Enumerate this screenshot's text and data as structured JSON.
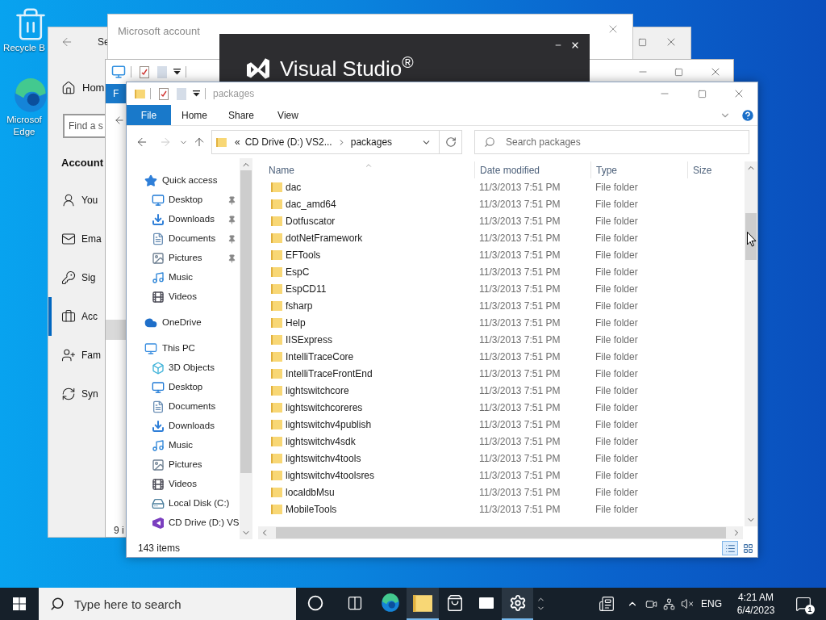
{
  "desktop_icons": [
    {
      "kind": "recycle-bin",
      "lines": [
        "Recycle B"
      ]
    },
    {
      "kind": "edge",
      "lines": [
        "Microsof",
        "Edge"
      ]
    }
  ],
  "settings_window": {
    "title": "Se",
    "home": "Hom",
    "search_placeholder": "Find a s",
    "heading": "Account",
    "nav": [
      {
        "kind": "user",
        "label": "You",
        "selected": false
      },
      {
        "kind": "mail",
        "label": "Ema",
        "selected": false
      },
      {
        "kind": "key",
        "label": "Sig",
        "selected": false
      },
      {
        "kind": "briefcase",
        "label": "Acc",
        "selected": true
      },
      {
        "kind": "family",
        "label": "Fam",
        "selected": false
      },
      {
        "kind": "sync",
        "label": "Syn",
        "selected": false
      }
    ]
  },
  "account_window": {
    "title": "Microsoft account"
  },
  "splash": {
    "title": "Visual Studio$^{®}$"
  },
  "back_explorer": {
    "menu_tab": "F",
    "status": "9 i"
  },
  "explorer": {
    "title": "packages",
    "ribbon_tabs": [
      {
        "kind": "file-menu",
        "label": "File"
      },
      {
        "kind": "tab",
        "label": "Home"
      },
      {
        "kind": "tab",
        "label": "Share"
      },
      {
        "kind": "tab",
        "label": "View"
      }
    ],
    "nav_buttons": [
      {
        "kind": "back",
        "disabled": false
      },
      {
        "kind": "forward",
        "disabled": true
      }
    ],
    "address": {
      "overflow": "«",
      "crumbs": [
        "CD Drive (D:) VS2...",
        "packages"
      ]
    },
    "search": {
      "placeholder": "Search packages"
    },
    "nav_pane": [
      {
        "kind": "quick-access",
        "label": "Quick access",
        "children": [
          {
            "kind": "desktop",
            "label": "Desktop",
            "pinned": true
          },
          {
            "kind": "downloads",
            "label": "Downloads",
            "pinned": true
          },
          {
            "kind": "documents",
            "label": "Documents",
            "pinned": true
          },
          {
            "kind": "pictures",
            "label": "Pictures",
            "pinned": true
          },
          {
            "kind": "music",
            "label": "Music",
            "pinned": false
          },
          {
            "kind": "videos",
            "label": "Videos",
            "pinned": false
          }
        ]
      },
      {
        "kind": "onedrive",
        "label": "OneDrive"
      },
      {
        "kind": "pc",
        "label": "This PC",
        "children": [
          {
            "kind": "objects",
            "label": "3D Objects"
          },
          {
            "kind": "desktop",
            "label": "Desktop"
          },
          {
            "kind": "documents",
            "label": "Documents"
          },
          {
            "kind": "downloads",
            "label": "Downloads"
          },
          {
            "kind": "music",
            "label": "Music"
          },
          {
            "kind": "pictures",
            "label": "Pictures"
          },
          {
            "kind": "videos",
            "label": "Videos"
          },
          {
            "kind": "disk",
            "label": "Local Disk (C:)"
          },
          {
            "kind": "cd",
            "label": "CD Drive (D:) VS"
          }
        ]
      }
    ],
    "columns": [
      "Name",
      "Date modified",
      "Type",
      "Size"
    ],
    "rows": [
      {
        "name": "dac",
        "date": "11/3/2013 7:51 PM",
        "type": "File folder"
      },
      {
        "name": "dac_amd64",
        "date": "11/3/2013 7:51 PM",
        "type": "File folder"
      },
      {
        "name": "Dotfuscator",
        "date": "11/3/2013 7:51 PM",
        "type": "File folder"
      },
      {
        "name": "dotNetFramework",
        "date": "11/3/2013 7:51 PM",
        "type": "File folder"
      },
      {
        "name": "EFTools",
        "date": "11/3/2013 7:51 PM",
        "type": "File folder"
      },
      {
        "name": "EspC",
        "date": "11/3/2013 7:51 PM",
        "type": "File folder"
      },
      {
        "name": "EspCD11",
        "date": "11/3/2013 7:51 PM",
        "type": "File folder"
      },
      {
        "name": "fsharp",
        "date": "11/3/2013 7:51 PM",
        "type": "File folder"
      },
      {
        "name": "Help",
        "date": "11/3/2013 7:51 PM",
        "type": "File folder"
      },
      {
        "name": "IISExpress",
        "date": "11/3/2013 7:51 PM",
        "type": "File folder"
      },
      {
        "name": "IntelliTraceCore",
        "date": "11/3/2013 7:51 PM",
        "type": "File folder"
      },
      {
        "name": "IntelliTraceFrontEnd",
        "date": "11/3/2013 7:51 PM",
        "type": "File folder"
      },
      {
        "name": "lightswitchcore",
        "date": "11/3/2013 7:51 PM",
        "type": "File folder"
      },
      {
        "name": "lightswitchcoreres",
        "date": "11/3/2013 7:51 PM",
        "type": "File folder"
      },
      {
        "name": "lightswitchv4publish",
        "date": "11/3/2013 7:51 PM",
        "type": "File folder"
      },
      {
        "name": "lightswitchv4sdk",
        "date": "11/3/2013 7:51 PM",
        "type": "File folder"
      },
      {
        "name": "lightswitchv4tools",
        "date": "11/3/2013 7:51 PM",
        "type": "File folder"
      },
      {
        "name": "lightswitchv4toolsres",
        "date": "11/3/2013 7:51 PM",
        "type": "File folder"
      },
      {
        "name": "localdbMsu",
        "date": "11/3/2013 7:51 PM",
        "type": "File folder"
      },
      {
        "name": "MobileTools",
        "date": "11/3/2013 7:51 PM",
        "type": "File folder"
      }
    ],
    "status": "143 items",
    "views": [
      {
        "kind": "details",
        "selected": true
      },
      {
        "kind": "large-icons",
        "selected": false
      }
    ]
  },
  "taskbar": {
    "search_placeholder": "Type here to search",
    "apps": [
      {
        "kind": "cortana",
        "running": false
      },
      {
        "kind": "task-view",
        "running": false
      },
      {
        "kind": "edge",
        "running": false
      },
      {
        "kind": "explorer",
        "running": true
      },
      {
        "kind": "store",
        "running": false
      },
      {
        "kind": "mail",
        "running": false
      },
      {
        "kind": "settings",
        "running": true
      }
    ],
    "language": "ENG",
    "time": "4:21 AM",
    "date": "6/4/2023",
    "notifications": "1"
  }
}
